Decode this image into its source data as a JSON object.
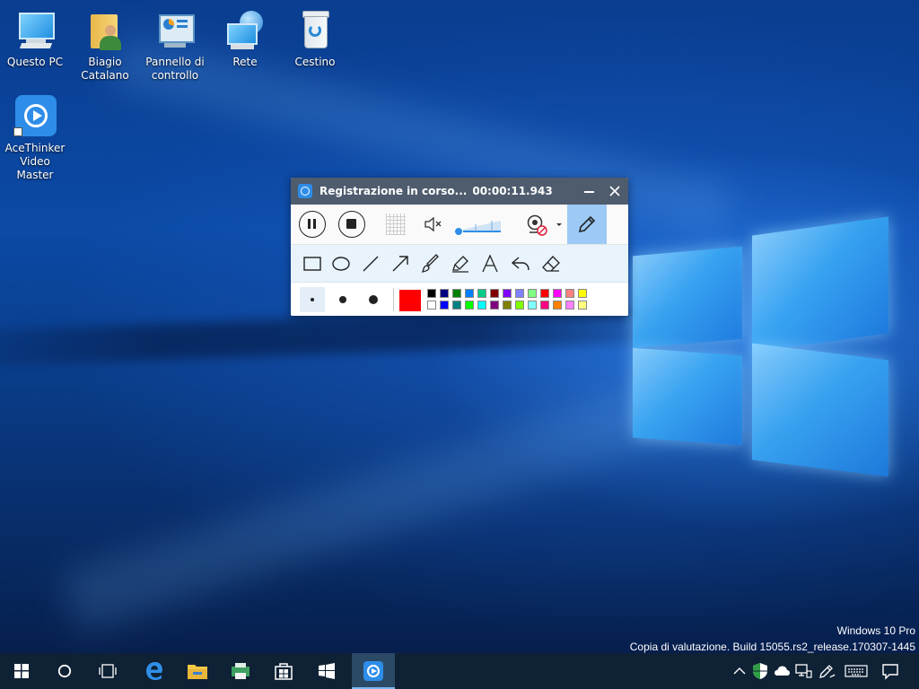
{
  "desktop": {
    "icons": [
      {
        "label": "Questo PC",
        "icon": "computer-icon"
      },
      {
        "label": "Biagio\nCatalano",
        "icon": "user-folder-icon"
      },
      {
        "label": "Pannello di\ncontrollo",
        "icon": "control-panel-icon"
      },
      {
        "label": "Rete",
        "icon": "network-icon"
      },
      {
        "label": "Cestino",
        "icon": "recycle-bin-icon"
      },
      {
        "label": "AceThinker\nVideo Master",
        "icon": "acethinker-icon"
      }
    ],
    "watermark": {
      "line1": "Windows 10 Pro",
      "line2": "Copia di valutazione. Build 15055.rs2_release.170307-1445"
    }
  },
  "recorder": {
    "title": "Registrazione in corso...",
    "timer": "00:00:11.943",
    "accent": "#2e8de8",
    "volume_level": 0.05,
    "selected_color": "#ff0000",
    "palette_row1": [
      "#000000",
      "#000080",
      "#008000",
      "#0080ff",
      "#00cc88",
      "#800000",
      "#8000ff",
      "#8080ff",
      "#80ff80",
      "#ff0000",
      "#ff00ff",
      "#ff8080",
      "#ffff00"
    ],
    "palette_row2": [
      "#ffffff",
      "#0000ff",
      "#008080",
      "#00ff00",
      "#00ffff",
      "#800080",
      "#808000",
      "#80ff00",
      "#80ffff",
      "#ff0080",
      "#ff8000",
      "#ff80ff",
      "#ffff80"
    ]
  },
  "taskbar": {
    "background": "#0f2134"
  }
}
